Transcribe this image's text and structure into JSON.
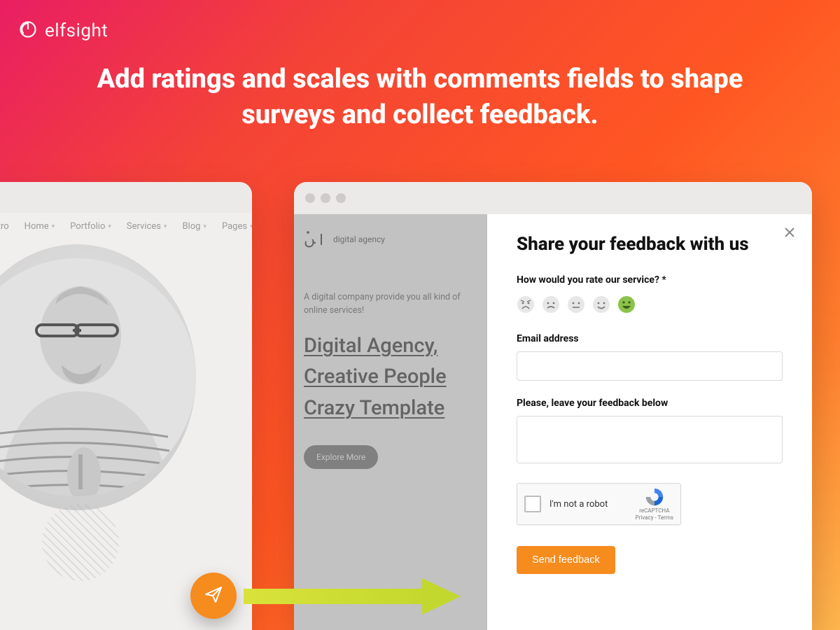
{
  "brand": {
    "name": "elfsight"
  },
  "headline": "Add ratings and scales with comments fields to shape surveys and collect feedback.",
  "left_window": {
    "nav": [
      "Intro",
      "Home",
      "Portfolio",
      "Services",
      "Blog",
      "Pages"
    ]
  },
  "right_window": {
    "site": {
      "logo_text": "digital agency",
      "subtitle": "A digital company provide you all kind of online services!",
      "heading_l1": "Digital Agency,",
      "heading_l2": "Creative People",
      "heading_l3": "Crazy Template",
      "cta": "Explore More"
    },
    "form": {
      "title": "Share your feedback with us",
      "rate_label": "How would you rate our service? *",
      "selected_rating": 5,
      "email_label": "Email address",
      "feedback_label": "Please, leave your feedback below",
      "recaptcha_text": "I'm not a robot",
      "recaptcha_brand": "reCAPTCHA",
      "recaptcha_terms": "Privacy - Terms",
      "submit": "Send feedback"
    }
  }
}
